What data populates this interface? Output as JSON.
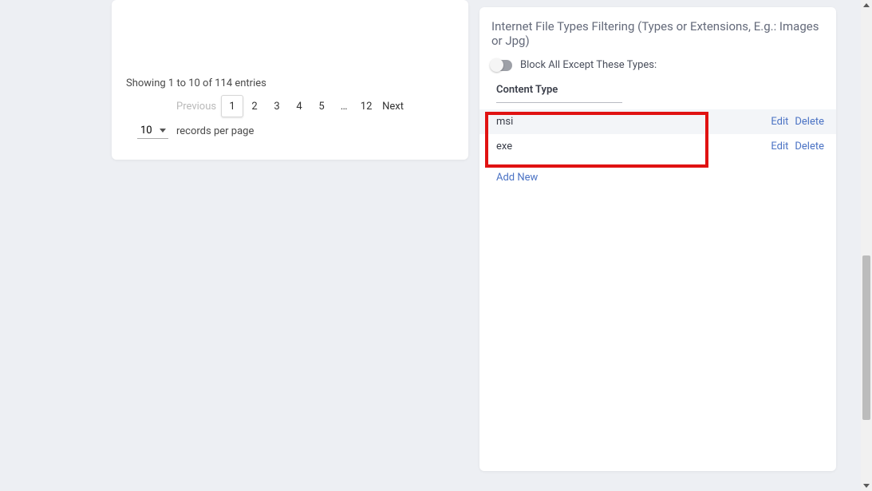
{
  "left": {
    "showing": "Showing 1 to 10 of 114 entries",
    "records_label": "records per page",
    "records_value": "10",
    "pagination": {
      "previous": "Previous",
      "next": "Next",
      "pages": [
        "1",
        "2",
        "3",
        "4",
        "5",
        "…",
        "12"
      ],
      "active_index": 0
    }
  },
  "right": {
    "title": "Internet File Types Filtering (Types or Extensions, E.g.: Images or Jpg)",
    "toggle_label": "Block All Except These Types:",
    "content_type_header": "Content Type",
    "rows": [
      {
        "ext": "msi",
        "edit": "Edit",
        "delete": "Delete"
      },
      {
        "ext": "exe",
        "edit": "Edit",
        "delete": "Delete"
      }
    ],
    "add_new": "Add New"
  }
}
